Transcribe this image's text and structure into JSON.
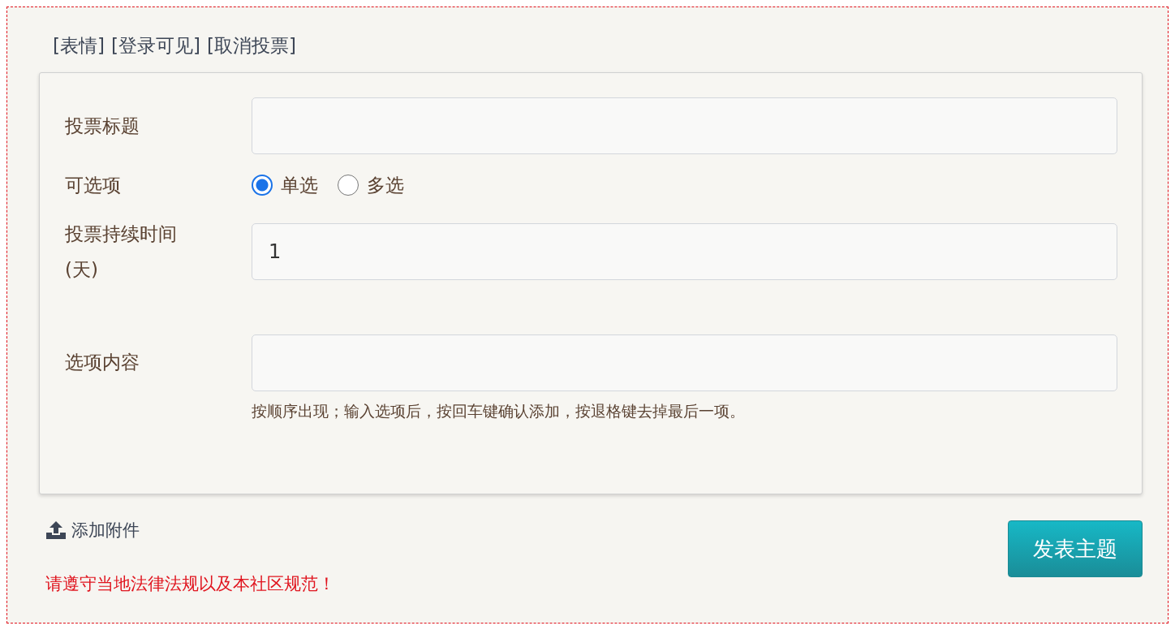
{
  "toolbar_links": [
    "[表情]",
    "[登录可见]",
    "[取消投票]"
  ],
  "form": {
    "rows": [
      {
        "kind": "text",
        "label": "投票标题"
      },
      {
        "kind": "radio",
        "label": "可选项",
        "options": [
          {
            "label": "单选",
            "selected": true
          },
          {
            "label": "多选",
            "selected": false
          }
        ]
      },
      {
        "kind": "text",
        "label": "投票持续时间(天)",
        "value": "1"
      },
      {
        "kind": "text",
        "label": "选项内容",
        "hint": "按顺序出现；输入选项后，按回车键确认添加，按退格键去掉最后一项。"
      }
    ]
  },
  "attach_link": "添加附件",
  "notice": "请遵守当地法律法规以及本社区规范！",
  "submit_button": "发表主题"
}
